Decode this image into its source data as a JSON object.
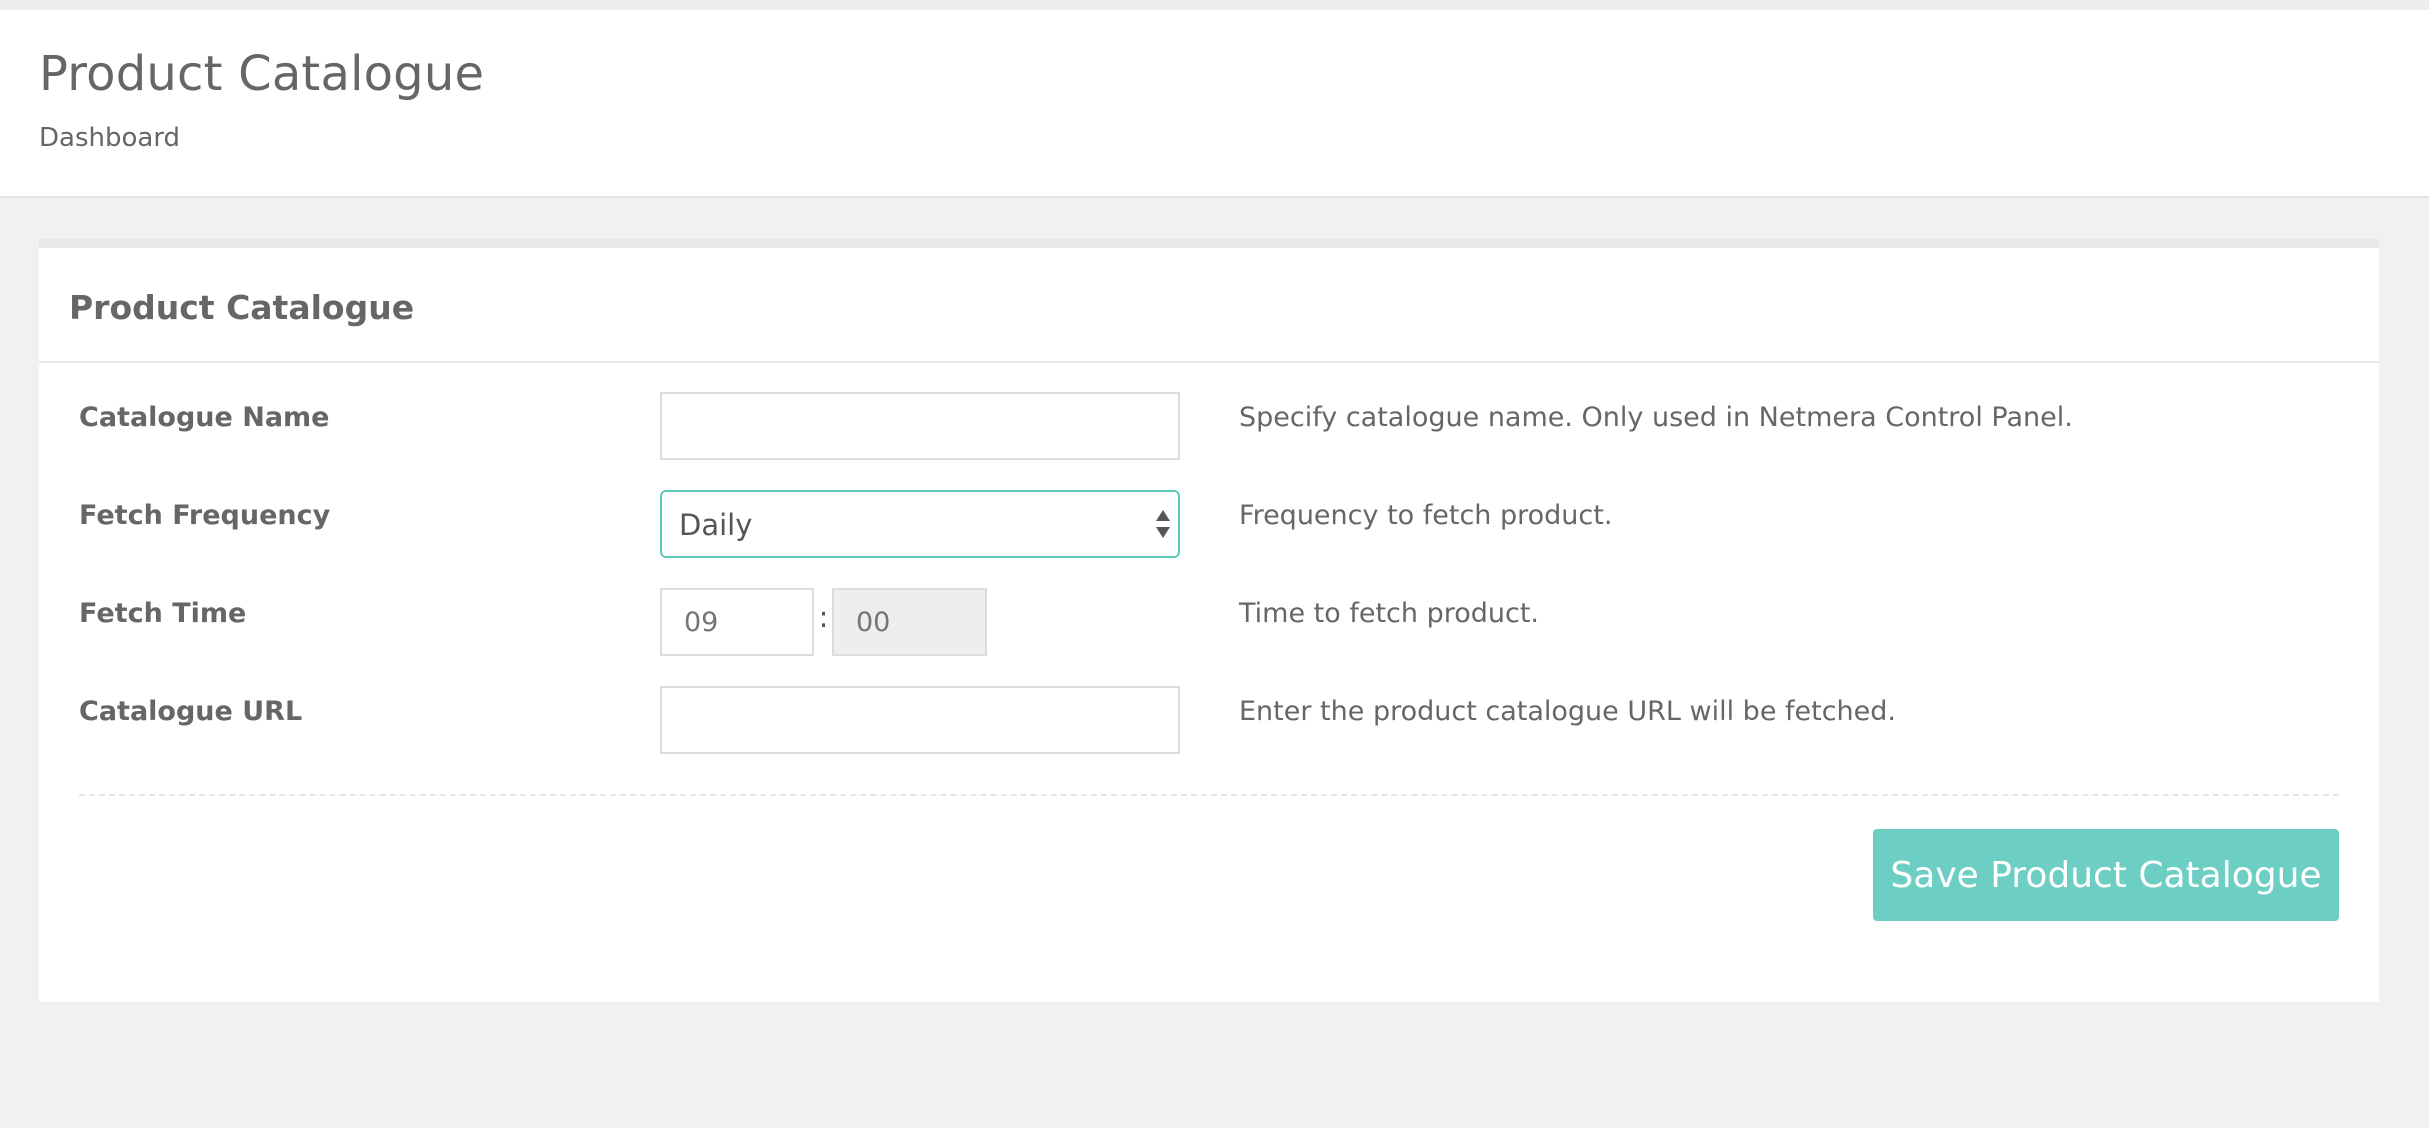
{
  "header": {
    "title": "Product Catalogue",
    "breadcrumb": "Dashboard"
  },
  "panel": {
    "title": "Product Catalogue",
    "fields": {
      "catalogue_name": {
        "label": "Catalogue Name",
        "value": "",
        "help": "Specify catalogue name. Only used in Netmera Control Panel."
      },
      "fetch_frequency": {
        "label": "Fetch Frequency",
        "value": "Daily",
        "help": "Frequency to fetch product."
      },
      "fetch_time": {
        "label": "Fetch Time",
        "hour_placeholder": "09",
        "separator": ":",
        "minute_placeholder": "00",
        "help": "Time to fetch product."
      },
      "catalogue_url": {
        "label": "Catalogue URL",
        "value": "",
        "help": "Enter the product catalogue URL will be fetched."
      }
    },
    "save_label": "Save Product Catalogue"
  },
  "colors": {
    "accent": "#6dcfc3",
    "focus_border": "#5cc9bb",
    "page_background": "#f1f1f1"
  }
}
